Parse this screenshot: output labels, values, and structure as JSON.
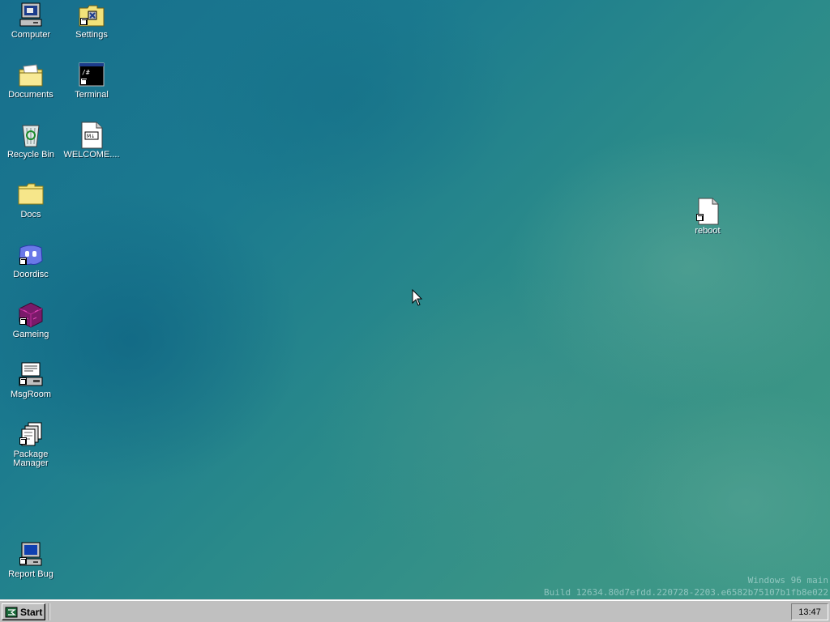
{
  "desktop": {
    "icons": [
      {
        "label": "Computer",
        "icon": "computer-icon"
      },
      {
        "label": "Settings",
        "icon": "settings-folder-icon"
      },
      {
        "label": "Documents",
        "icon": "documents-folder-icon"
      },
      {
        "label": "Terminal",
        "icon": "terminal-icon"
      },
      {
        "label": "Recycle Bin",
        "icon": "recycle-bin-icon"
      },
      {
        "label": "WELCOME....",
        "icon": "markdown-file-icon"
      },
      {
        "label": "Docs",
        "icon": "folder-icon"
      },
      {
        "label": "Doordisc",
        "icon": "doordisc-icon"
      },
      {
        "label": "Gameing",
        "icon": "cube-icon"
      },
      {
        "label": "MsgRoom",
        "icon": "msgroom-icon"
      },
      {
        "label": "Package Manager",
        "icon": "package-manager-icon"
      },
      {
        "label": "Report Bug",
        "icon": "report-bug-icon"
      },
      {
        "label": "reboot",
        "icon": "file-icon"
      }
    ],
    "watermark": {
      "line1": "Windows 96 main",
      "line2": "Build 12634.80d7efdd.220728-2203.e6582b75107b1fb8e022"
    }
  },
  "taskbar": {
    "start_label": "Start",
    "clock": "13:47"
  }
}
